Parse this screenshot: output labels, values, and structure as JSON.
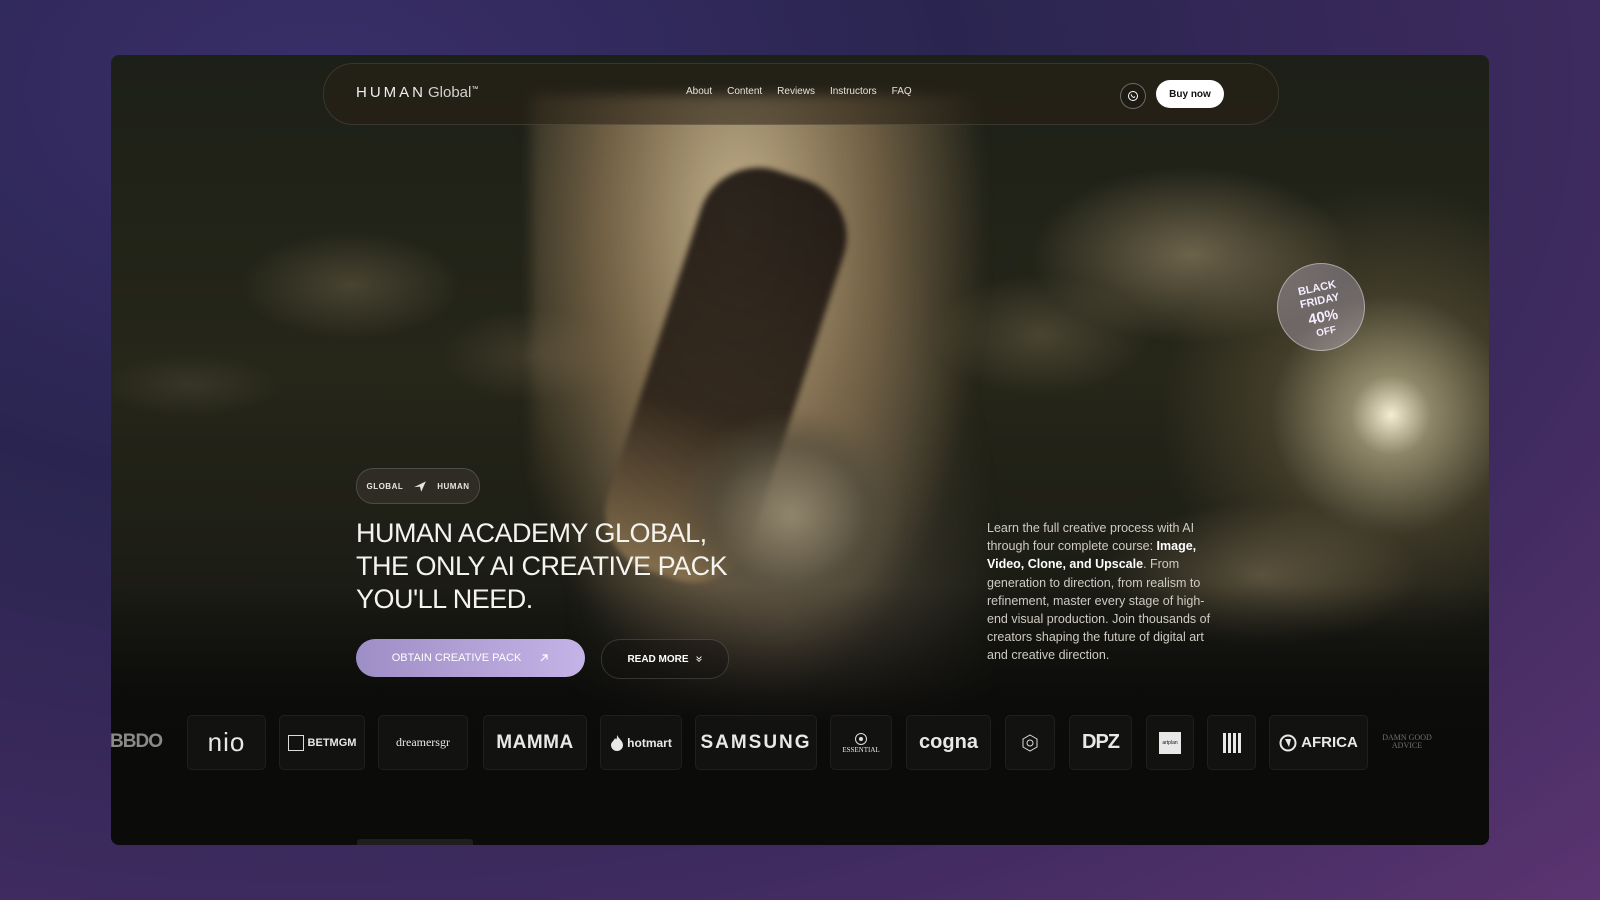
{
  "nav": {
    "logo_strong": "HUMAN",
    "logo_light": "Global",
    "logo_mark": "™",
    "links": [
      "About",
      "Content",
      "Reviews",
      "Instructors",
      "FAQ"
    ],
    "buy_label": "Buy now",
    "whatsapp_icon": "whatsapp-icon"
  },
  "promo_stamp": {
    "line1": "BLACK",
    "line2": "FRIDAY",
    "line3": "40%",
    "line4": "OFF"
  },
  "hero": {
    "tag_left": "GLOBAL",
    "tag_right": "HUMAN",
    "title": "HUMAN ACADEMY GLOBAL, THE ONLY AI CREATIVE PACK YOU'LL NEED.",
    "cta_primary": "OBTAIN CREATIVE PACK",
    "cta_secondary": "READ MORE",
    "desc_1": "Learn the full creative process with AI through four complete course: ",
    "desc_bold": "Image, Video, Clone, and Upscale",
    "desc_2": ". From generation to direction, from realism to refinement, master every stage of high-end visual production. Join thousands of creators shaping the future of digital art and creative direction."
  },
  "logos": {
    "bbdo": "BBDO",
    "nio": "nio",
    "betmgm": "BETMGM",
    "dreamers": "dreamersgr",
    "mamma": "MAMMA",
    "hotmart": "hotmart",
    "samsung": "SAMSUNG",
    "essential": "ESSENTIAL",
    "cogna": "cogna",
    "sc": "",
    "dpz": "DPZ",
    "artplan": "artplan",
    "africa": "AFRICA",
    "dama": "DAMN GOOD ADVICE"
  },
  "colors": {
    "accent": "#b3a2db",
    "button_bg": "#ffffff"
  }
}
